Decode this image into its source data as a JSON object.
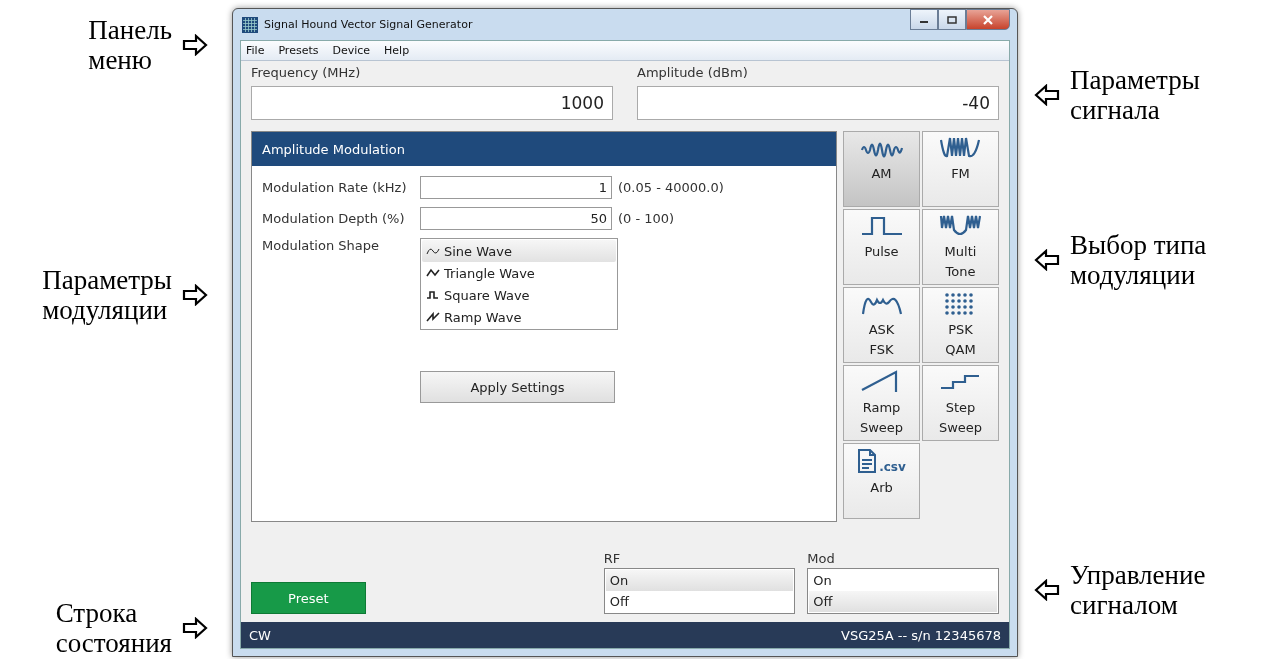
{
  "annotations_left": [
    {
      "text": "Панель\nменю"
    },
    {
      "text": "Параметры\nмодуляции"
    },
    {
      "text": "Строка\nсостояния"
    }
  ],
  "annotations_right": [
    {
      "text": "Параметры\nсигнала"
    },
    {
      "text": "Выбор типа\nмодуляции"
    },
    {
      "text": "Управление\nсигналом"
    }
  ],
  "window": {
    "title": "Signal Hound Vector Signal Generator"
  },
  "menu": [
    "File",
    "Presets",
    "Device",
    "Help"
  ],
  "signal": [
    {
      "label": "Frequency (MHz)",
      "value": "1000"
    },
    {
      "label": "Amplitude (dBm)",
      "value": "-40"
    }
  ],
  "panel": {
    "title": "Amplitude Modulation",
    "fields": [
      {
        "label": "Modulation Rate (kHz)",
        "value": "1",
        "range": "(0.05 - 40000.0)"
      },
      {
        "label": "Modulation Depth (%)",
        "value": "50",
        "range": "(0 - 100)"
      }
    ],
    "shape": {
      "label": "Modulation Shape",
      "options": [
        {
          "kind": "sine",
          "label": "Sine Wave",
          "selected": true
        },
        {
          "kind": "triangle",
          "label": "Triangle Wave",
          "selected": false
        },
        {
          "kind": "square",
          "label": "Square Wave",
          "selected": false
        },
        {
          "kind": "ramp",
          "label": "Ramp Wave",
          "selected": false
        }
      ]
    },
    "apply": "Apply Settings"
  },
  "mod_types": [
    {
      "kind": "am",
      "label": "AM",
      "selected": true
    },
    {
      "kind": "fm",
      "label": "FM",
      "selected": false
    },
    {
      "kind": "pulse",
      "label": "Pulse",
      "selected": false
    },
    {
      "kind": "multitone",
      "label": "Multi\nTone",
      "selected": false
    },
    {
      "kind": "askfsk",
      "label": "ASK\nFSK",
      "selected": false
    },
    {
      "kind": "constellation",
      "label": "PSK\nQAM",
      "selected": false
    },
    {
      "kind": "ramp",
      "label": "Ramp\nSweep",
      "selected": false
    },
    {
      "kind": "step",
      "label": "Step\nSweep",
      "selected": false
    },
    {
      "kind": "file",
      "icon_text": ".csv",
      "label": "Arb",
      "selected": false
    }
  ],
  "preset": "Preset",
  "outputs": [
    {
      "label": "RF",
      "options": [
        {
          "label": "On",
          "selected": true
        },
        {
          "label": "Off",
          "selected": false
        }
      ]
    },
    {
      "label": "Mod",
      "options": [
        {
          "label": "On",
          "selected": false
        },
        {
          "label": "Off",
          "selected": true
        }
      ]
    }
  ],
  "status_bar": {
    "left": "CW",
    "right": "VSG25A -- s/n 12345678"
  }
}
